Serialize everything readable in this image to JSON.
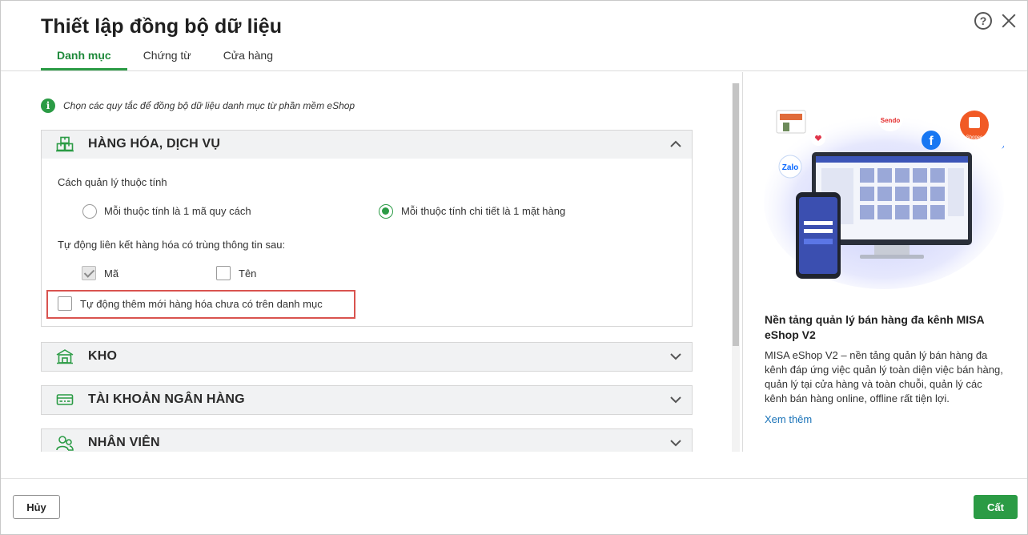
{
  "dialog": {
    "title": "Thiết lập đồng bộ dữ liệu",
    "tabs": [
      {
        "label": "Danh mục",
        "active": true
      },
      {
        "label": "Chứng từ",
        "active": false
      },
      {
        "label": "Cửa hàng",
        "active": false
      }
    ],
    "help_icon": "?"
  },
  "info": {
    "icon": "i",
    "text": "Chọn các quy tắc để đồng bộ dữ liệu danh mục từ phần mềm eShop"
  },
  "sections": {
    "goods": {
      "title": "HÀNG HÓA, DỊCH VỤ",
      "expanded": true,
      "attr_label": "Cách quản lý thuộc tính",
      "radio_1": "Mỗi thuộc tính là 1 mã quy cách",
      "radio_2": "Mỗi thuộc tính chi tiết là 1 mặt hàng",
      "selected_radio": 2,
      "link_label": "Tự động liên kết hàng hóa có trùng thông tin sau:",
      "check_code": "Mã",
      "check_code_checked": true,
      "check_name": "Tên",
      "check_name_checked": false,
      "auto_add": "Tự động thêm mới hàng hóa chưa có trên danh mục",
      "auto_add_checked": false
    },
    "warehouse": {
      "title": "KHO",
      "expanded": false
    },
    "bank": {
      "title": "TÀI KHOẢN NGÂN HÀNG",
      "expanded": false
    },
    "staff": {
      "title": "NHÂN VIÊN",
      "expanded": false
    }
  },
  "promo": {
    "title": "Nền tảng quản lý bán hàng đa kênh MISA eShop V2",
    "description": "MISA eShop V2 – nền tảng quản lý bán hàng đa kênh đáp ứng việc quản lý toàn diện việc bán hàng, quản lý tại cửa hàng và toàn chuỗi, quản lý các kênh bán hàng online, offline rất tiện lợi.",
    "link": "Xem thêm",
    "logos": {
      "zalo": "Zalo",
      "sendo": "Sendo",
      "facebook": "f",
      "shopee": "Shopee"
    }
  },
  "footer": {
    "cancel": "Hủy",
    "save": "Cất"
  },
  "colors": {
    "accent": "#2b9b45",
    "highlight": "#d9534f",
    "link": "#1a73b8"
  }
}
